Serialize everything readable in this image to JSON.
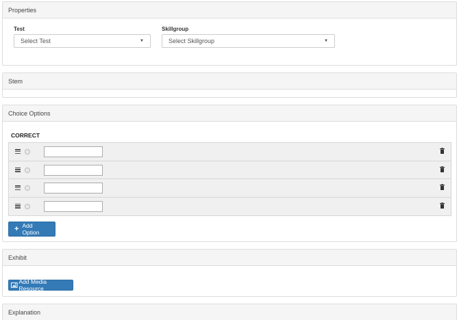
{
  "properties": {
    "title": "Properties",
    "test_label": "Test",
    "test_value": "Select Test",
    "skillgroup_label": "Skillgroup",
    "skillgroup_value": "Select Skillgroup"
  },
  "stem": {
    "title": "Stem"
  },
  "choices": {
    "title": "Choice Options",
    "correct_label": "CORRECT",
    "options": [
      {
        "value": ""
      },
      {
        "value": ""
      },
      {
        "value": ""
      },
      {
        "value": ""
      }
    ],
    "add_option_label": "Add Option"
  },
  "exhibit": {
    "title": "Exhibit",
    "add_media_label": "Add Media Resource"
  },
  "explanation": {
    "title": "Explanation"
  },
  "colors": {
    "primary": "#337ab7",
    "panel_header": "#f5f5f5",
    "border": "#dcdcdc"
  },
  "icons": [
    "caret-down-icon",
    "drag-handle-icon",
    "radio-icon",
    "trash-icon",
    "plus-icon",
    "image-icon"
  ]
}
